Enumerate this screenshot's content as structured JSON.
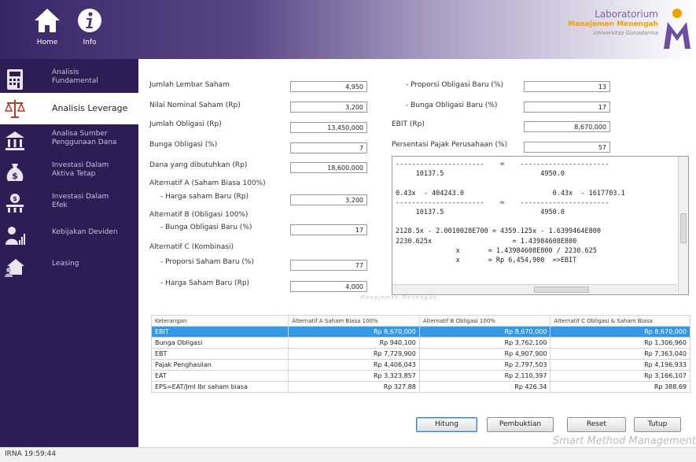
{
  "header": {
    "home_label": "Home",
    "info_label": "Info",
    "logo": {
      "line1": "Laboratorium",
      "line2": "Manajemen Menengah",
      "line3": "Universitas Gunadarma"
    }
  },
  "sidebar": {
    "items": [
      {
        "label": "Analisis Fundamental",
        "icon": "calculator-icon"
      },
      {
        "label": "Analisis Leverage",
        "icon": "scale-icon"
      },
      {
        "label": "Analisa Sumber Penggunaan Dana",
        "icon": "bank-icon"
      },
      {
        "label": "Investasi Dalam Aktiva Tetap",
        "icon": "money-bag-icon"
      },
      {
        "label": "Investasi Dalam Efek",
        "icon": "stock-icon"
      },
      {
        "label": "Kebijakan Deviden",
        "icon": "person-chart-icon"
      },
      {
        "label": "Leasing",
        "icon": "house-people-icon"
      }
    ]
  },
  "form": {
    "jumlah_lembar_saham": {
      "label": "Jumlah Lembar Saham",
      "value": "4,950"
    },
    "nilai_nominal_saham": {
      "label": "Nilai Nominal Saham (Rp)",
      "value": "3,200"
    },
    "jumlah_obligasi": {
      "label": "Jumlah Obligasi (Rp)",
      "value": "13,450,000"
    },
    "bunga_obligasi": {
      "label": "Bunga Obligasi (%)",
      "value": "7"
    },
    "dana_dibutuhkan": {
      "label": "Dana yang dibutuhkan (Rp)",
      "value": "18,600,000"
    },
    "alt_a_title": "Alternatif A (Saham Biasa 100%)",
    "harga_saham_baru_a": {
      "label": "- Harga saham Baru (Rp)",
      "value": "3,200"
    },
    "alt_b_title": "Alternatif B (Obligasi 100%)",
    "bunga_obligasi_baru_b": {
      "label": "- Bunga Obligasi Baru (%)",
      "value": "17"
    },
    "alt_c_title": "Alternatif C (Kombinasi)",
    "proporsi_saham_baru_c": {
      "label": "- Proporsi Saham Baru (%)",
      "value": "77"
    },
    "harga_saham_baru_c": {
      "label": "- Harga Saham Baru (Rp)",
      "value": "4,000"
    },
    "proporsi_obligasi_baru": {
      "label": "- Proporsi Obligasi Baru (%)",
      "value": "13"
    },
    "bunga_obligasi_baru": {
      "label": "- Bunga Obligasi Baru (%)",
      "value": "17"
    },
    "ebit": {
      "label": "EBIT (Rp)",
      "value": "8,670,000"
    },
    "pajak": {
      "label": "Persentasi Pajak Perusahaan (%)",
      "value": "57"
    }
  },
  "output_text": "----------------------    =    ----------------------\n     10137.5                        4950.0\n\n0.43x  - 404243.0                      0.43x  - 1617703.1\n----------------------    =    ----------------------\n     10137.5                        4950.0\n\n2128.5x - 2.0010028E700 = 4359.125x - 1.6399464E800\n2230.625x                    = 1.43984608E800\n               x       = 1.43984608E800 / 2230.625\n               x       = Rp 6,454,900  =>EBIT",
  "table": {
    "headers": [
      "Keterangan",
      "Alternatif A Saham Biasa 100%",
      "Alternatif B Obligasi 100%",
      "Alternatif C Obligasi & Saham Biasa"
    ],
    "rows": [
      [
        "EBIT",
        "Rp 8,670,000",
        "Rp 8,670,000",
        "Rp 8,670,000"
      ],
      [
        "Bunga Obligasi",
        "Rp 940,100",
        "Rp 3,762,100",
        "Rp 1,306,960"
      ],
      [
        "EBT",
        "Rp 7,729,900",
        "Rp 4,907,900",
        "Rp 7,363,040"
      ],
      [
        "Pajak Penghasilan",
        "Rp 4,406,043",
        "Rp 2,797,503",
        "Rp 4,196,933"
      ],
      [
        "EAT",
        "Rp 3,323,857",
        "Rp 2,110,397",
        "Rp 3,166,107"
      ],
      [
        "EPS=EAT/Jml lbr saham biasa",
        "Rp 327.88",
        "Rp 426.34",
        "Rp 388.69"
      ]
    ]
  },
  "buttons": {
    "hitung": "Hitung",
    "pembuktian": "Pembuktian",
    "reset": "Reset",
    "tutup": "Tutup"
  },
  "brand": "Smart Method Management",
  "brand_watermark": "Manajemen Menengah",
  "status": "IRNA  19:59:44",
  "colors": {
    "sidebar_bg": "#2e1c55",
    "selection": "#3498e6",
    "accent": "#f0a000"
  }
}
